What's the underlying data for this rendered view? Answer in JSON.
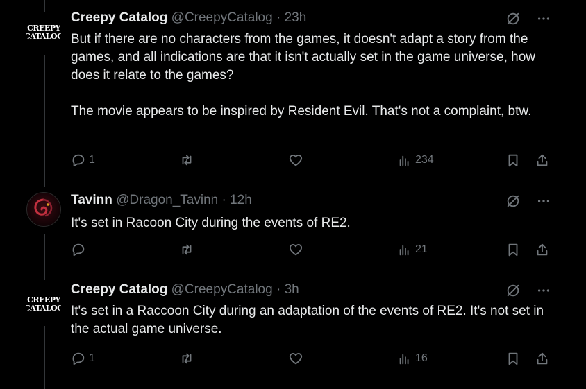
{
  "tweets": [
    {
      "name": "Creepy Catalog",
      "handle": "@CreepyCatalog",
      "time": "· 23h",
      "avatar_text": [
        "CREEPY",
        "CATALOG"
      ],
      "body": "But if there are no characters from the games, it doesn't adapt a story from the games, and all indications are that it isn't actually set in the game universe, how does it relate to the games?\n\nThe movie appears to be inspired by Resident Evil. That's not a complaint, btw.",
      "replies": "1",
      "retweets": "",
      "likes": "",
      "views": "234"
    },
    {
      "name": "Tavinn",
      "handle": "@Dragon_Tavinn",
      "time": "· 12h",
      "avatar_icon": "dragon-avatar-icon",
      "body": "It's set in Racoon City during the events of RE2.",
      "replies": "",
      "retweets": "",
      "likes": "",
      "views": "21"
    },
    {
      "name": "Creepy Catalog",
      "handle": "@CreepyCatalog",
      "time": "· 3h",
      "avatar_text": [
        "CREEPY",
        "CATALOG"
      ],
      "body": "It's set in a Raccoon City during an adaptation of the events of RE2. It's not set in the actual game universe.",
      "replies": "1",
      "retweets": "",
      "likes": "",
      "views": "16"
    }
  ],
  "icons": {
    "grok": "grok-icon",
    "more": "more-icon",
    "reply": "reply-icon",
    "retweet": "retweet-icon",
    "like": "like-icon",
    "views": "views-icon",
    "bookmark": "bookmark-icon",
    "share": "share-icon"
  },
  "colors": {
    "background": "#000000",
    "text": "#e7e9ea",
    "muted": "#71767b",
    "thread_line": "#333639"
  }
}
